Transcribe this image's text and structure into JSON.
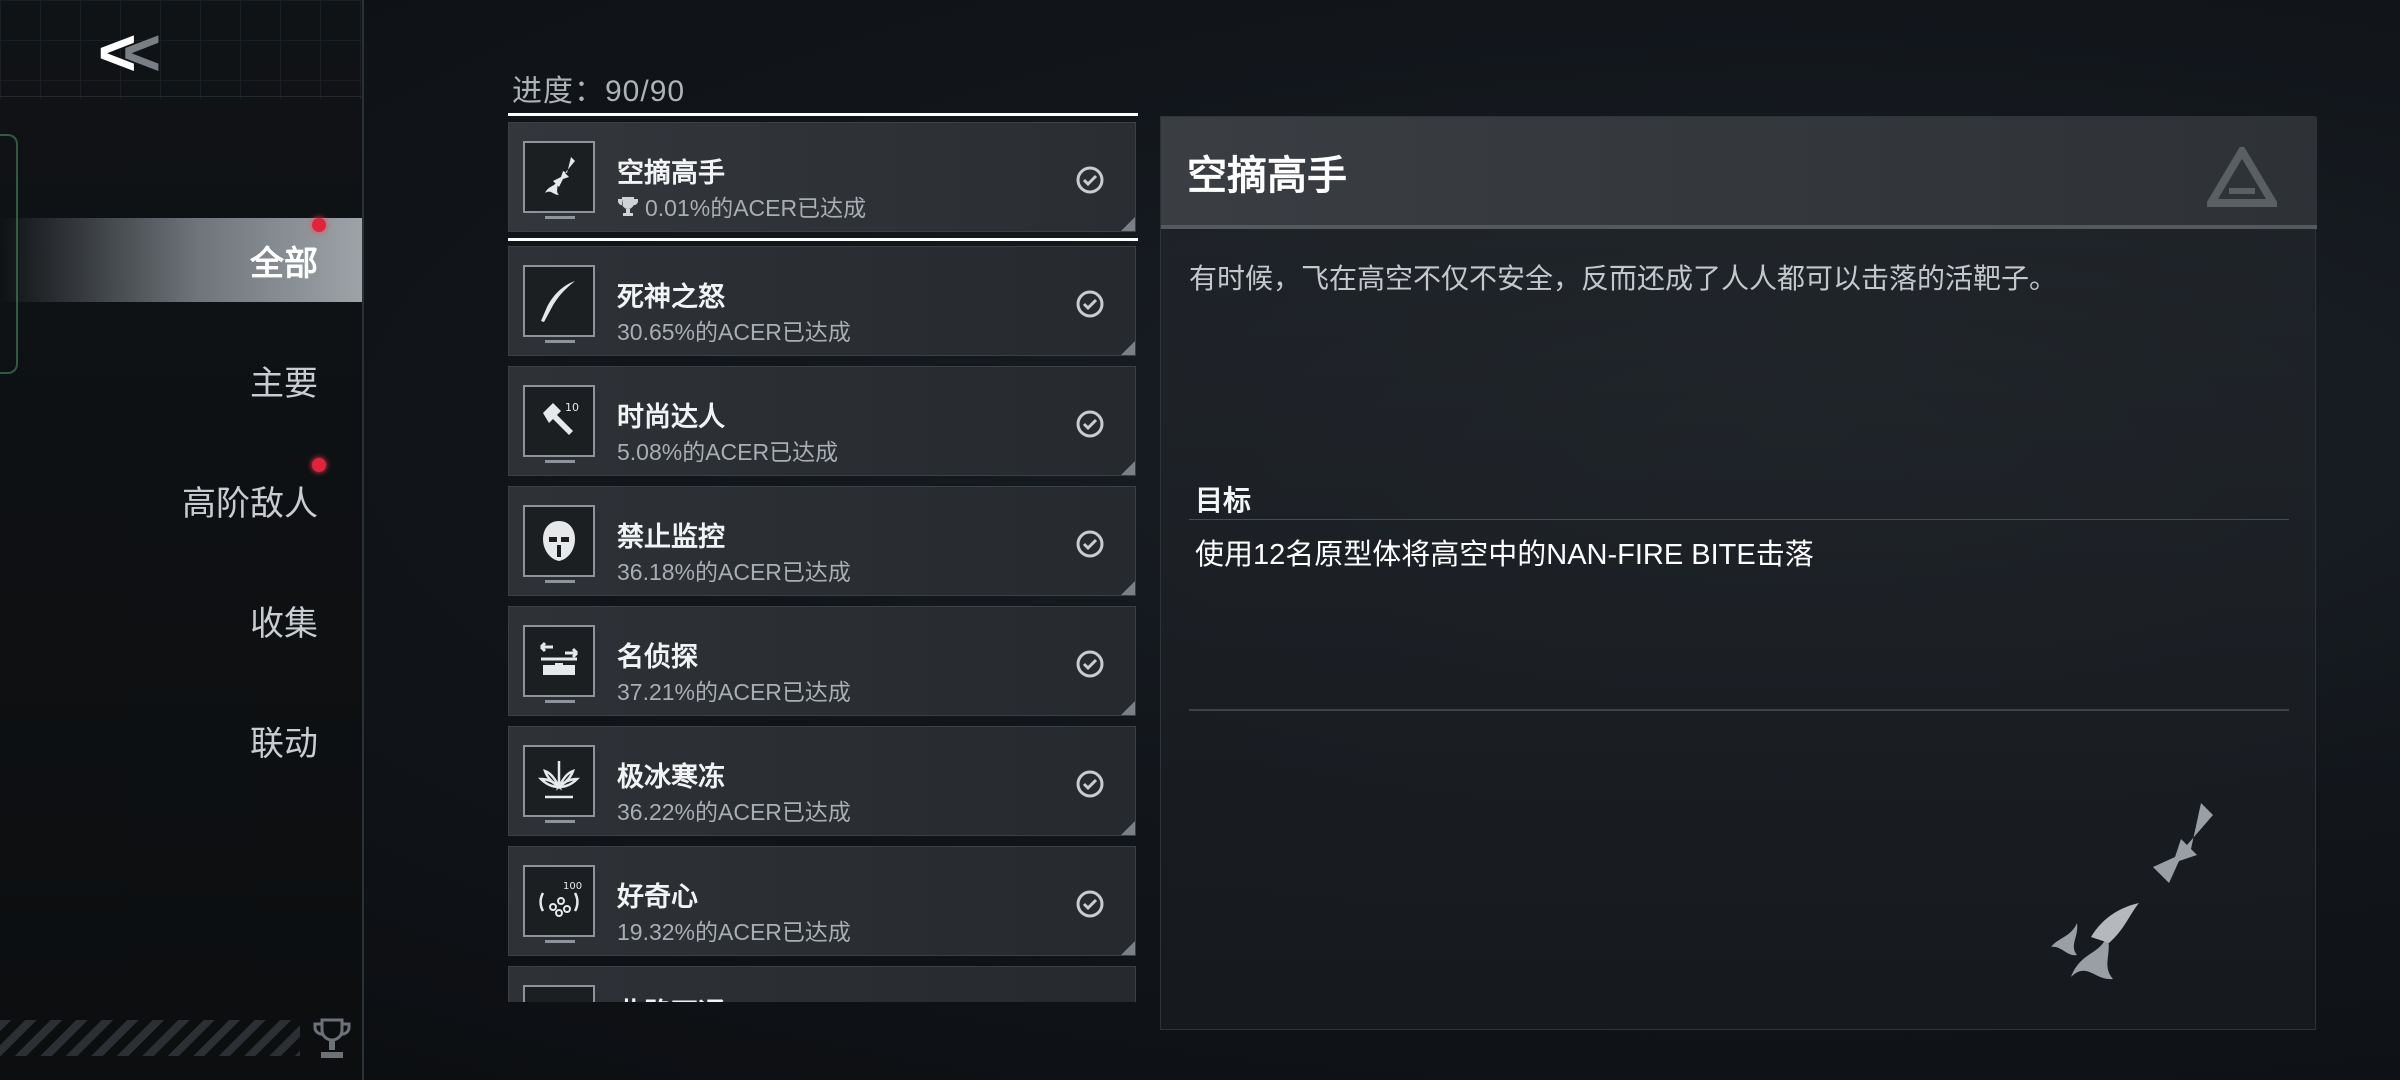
{
  "nav": {
    "back_icon": "double-chevron-left-icon",
    "items": [
      {
        "label": "全部",
        "active": true,
        "badge": true
      },
      {
        "label": "主要",
        "active": false,
        "badge": false
      },
      {
        "label": "高阶敌人",
        "active": false,
        "badge": true
      },
      {
        "label": "收集",
        "active": false,
        "badge": false
      },
      {
        "label": "联动",
        "active": false,
        "badge": false
      }
    ],
    "footer_icon": "trophy-icon"
  },
  "progress": {
    "label": "进度：90/90",
    "current": 90,
    "total": 90
  },
  "achievements": [
    {
      "title": "空摘高手",
      "rate": "0.01%的ACER已达成",
      "rarity_icon": "trophy-icon",
      "icon": "jet-crash-icon",
      "completed": true,
      "selected": true
    },
    {
      "title": "死神之怒",
      "rate": "30.65%的ACER已达成",
      "icon": "scythe-icon",
      "completed": true,
      "selected": false
    },
    {
      "title": "时尚达人",
      "rate": "5.08%的ACER已达成",
      "icon": "hammer-10-icon",
      "completed": true,
      "selected": false
    },
    {
      "title": "禁止监控",
      "rate": "36.18%的ACER已达成",
      "icon": "mask-face-icon",
      "completed": true,
      "selected": false
    },
    {
      "title": "名侦探",
      "rate": "37.21%的ACER已达成",
      "icon": "detective-arrows-icon",
      "completed": true,
      "selected": false
    },
    {
      "title": "极冰寒冻",
      "rate": "36.22%的ACER已达成",
      "icon": "ice-crystal-icon",
      "completed": true,
      "selected": false
    },
    {
      "title": "好奇心",
      "rate": "19.32%的ACER已达成",
      "icon": "curious-100-icon",
      "completed": true,
      "selected": false
    },
    {
      "title": "此路不通",
      "rate": "",
      "icon": "road-block-icon",
      "completed": true,
      "selected": false
    }
  ],
  "detail": {
    "title": "空摘高手",
    "description": "有时候，飞在高空不仅不安全，反而还成了人人都可以击落的活靶子。",
    "goal_label": "目标",
    "goal_text": "使用12名原型体将高空中的NAN-FIRE BITE击落",
    "logo_icon": "triangle-logo-icon",
    "art_icon": "jet-crash-icon"
  },
  "colors": {
    "accent_white": "#ffffff",
    "badge_red": "#e2233a",
    "panel": "#2e3237"
  }
}
